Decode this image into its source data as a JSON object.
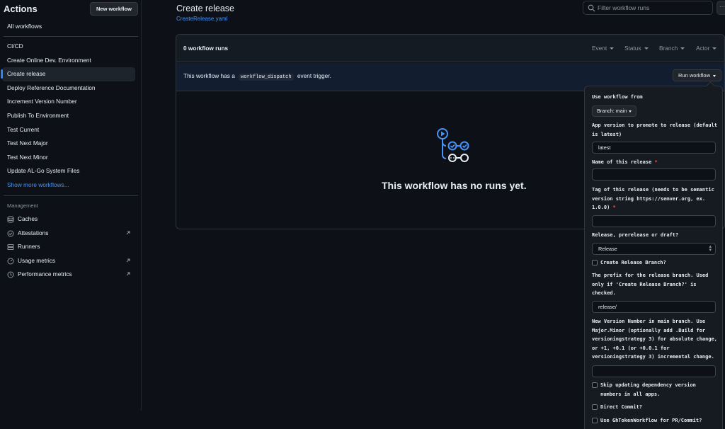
{
  "sidebar": {
    "title": "Actions",
    "new_workflow": "New workflow",
    "all_workflows": "All workflows",
    "items": [
      {
        "label": "CI/CD",
        "active": false
      },
      {
        "label": "Create Online Dev. Environment",
        "active": false
      },
      {
        "label": "Create release",
        "active": true
      },
      {
        "label": "Deploy Reference Documentation",
        "active": false
      },
      {
        "label": "Increment Version Number",
        "active": false
      },
      {
        "label": "Publish To Environment",
        "active": false
      },
      {
        "label": "Test Current",
        "active": false
      },
      {
        "label": "Test Next Major",
        "active": false
      },
      {
        "label": "Test Next Minor",
        "active": false
      },
      {
        "label": "Update AL-Go System Files",
        "active": false
      }
    ],
    "show_more": "Show more workflows...",
    "management_title": "Management",
    "management": [
      {
        "label": "Caches",
        "icon": "database-icon",
        "external": false
      },
      {
        "label": "Attestations",
        "icon": "check-circle-icon",
        "external": true
      },
      {
        "label": "Runners",
        "icon": "server-icon",
        "external": false
      },
      {
        "label": "Usage metrics",
        "icon": "gauge-icon",
        "external": true
      },
      {
        "label": "Performance metrics",
        "icon": "clock-icon",
        "external": true
      }
    ]
  },
  "header": {
    "title": "Create release",
    "file": "CreateRelease.yaml",
    "filter_placeholder": "Filter workflow runs",
    "more": "···"
  },
  "runs": {
    "count_label": "0 workflow runs",
    "filters": [
      "Event",
      "Status",
      "Branch",
      "Actor"
    ],
    "dispatch_prefix": "This workflow has a",
    "dispatch_code": "workflow_dispatch",
    "dispatch_suffix": "event trigger.",
    "run_button": "Run workflow",
    "empty_title": "This workflow has no runs yet."
  },
  "panel": {
    "use_from": "Use workflow from",
    "branch": "Branch: main",
    "app_version_label": "App version to promote to release (default is latest)",
    "app_version_value": "latest",
    "name_label": "Name of this release",
    "name_value": "",
    "tag_label": "Tag of this release (needs to be semantic version string https://semver.org, ex. 1.0.0)",
    "tag_value": "",
    "release_type_label": "Release, prerelease or draft?",
    "release_type_value": "Release",
    "create_branch_label": "Create Release Branch?",
    "prefix_label": "The prefix for the release branch. Used only if 'Create Release Branch?' is checked.",
    "prefix_value": "release/",
    "new_version_label": "New Version Number in main branch. Use Major.Minor (optionally add .Build for versioningstrategy 3) for absolute change, or +1, +0.1 (or +0.0.1 for versioningstrategy 3) incremental change.",
    "new_version_value": "",
    "skip_update_label": "Skip updating dependency version numbers in all apps.",
    "direct_commit_label": "Direct Commit?",
    "ghtoken_label": "Use GhTokenWorkflow for PR/Commit?",
    "required_mark": "*"
  },
  "colors": {
    "background": "#0d1117",
    "accent": "#2f81f7",
    "link": "#4493f8",
    "required": "#f85149"
  }
}
